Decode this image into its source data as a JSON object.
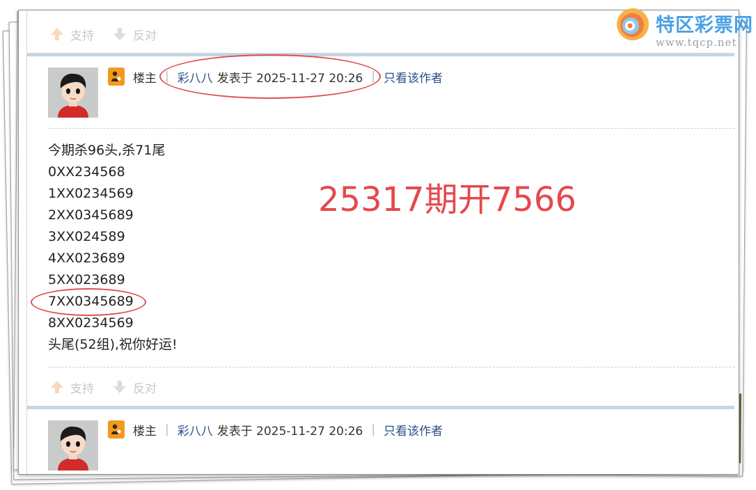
{
  "watermark": {
    "title": "特区彩票网",
    "url": "www.tqcp.net"
  },
  "votes": {
    "support_label": "支持",
    "oppose_label": "反对"
  },
  "post1": {
    "role": "楼主",
    "author": "彩八八",
    "posted": "发表于 2025-11-27 20:26",
    "only_author": "只看该作者",
    "lines": [
      "今期杀96头,杀71尾",
      "0XX234568",
      "1XX0234569",
      "2XX0345689",
      "3XX024589",
      "4XX023689",
      "5XX023689",
      "7XX0345689",
      "8XX0234569",
      "头尾(52组),祝你好运!"
    ],
    "headline": "25317期开7566"
  },
  "post2": {
    "role": "楼主",
    "author": "彩八八",
    "posted": "发表于 2025-11-27 20:26",
    "only_author": "只看该作者"
  },
  "colors": {
    "headline": "#e5484d",
    "annotation": "#e05050",
    "link": "#2a4f8a",
    "role_badge": "#f29a1f",
    "separator": "#c5d5e2"
  }
}
